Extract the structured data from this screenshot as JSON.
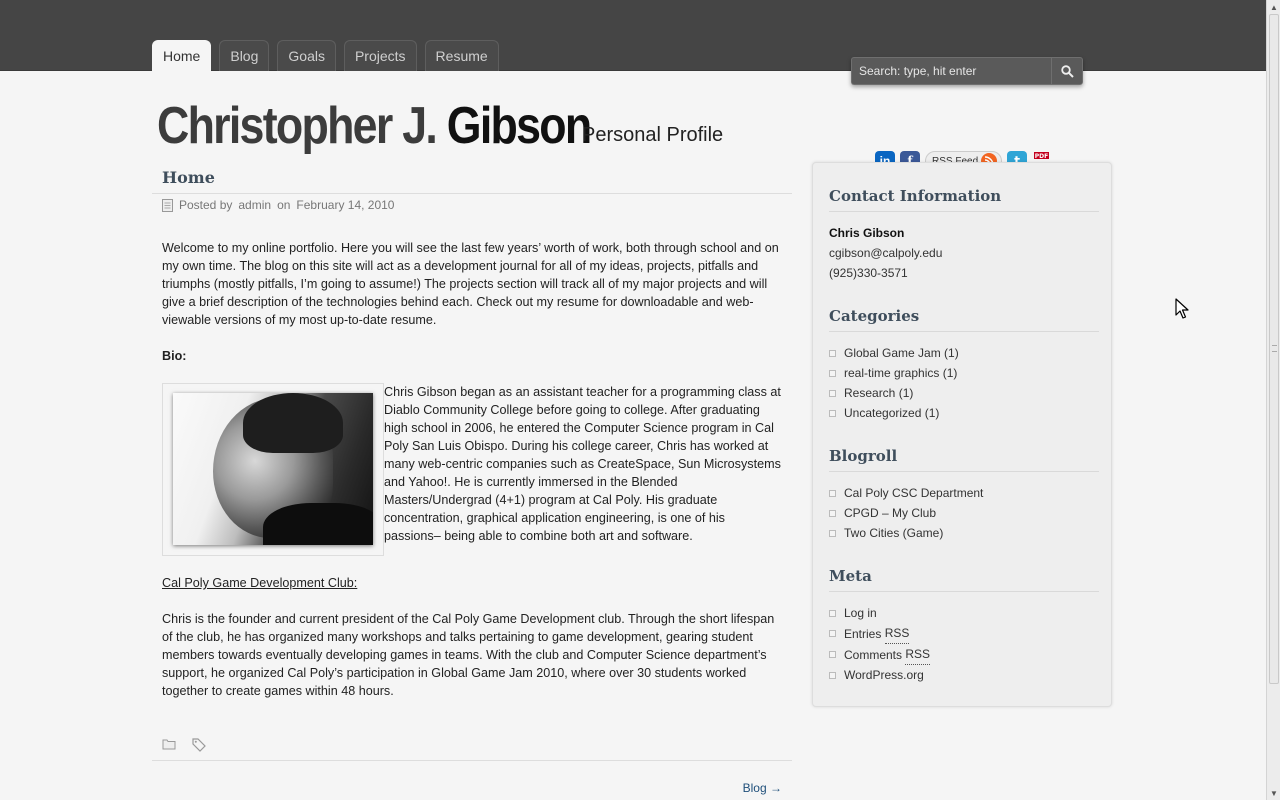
{
  "nav": {
    "tabs": [
      {
        "label": "Home",
        "active": true
      },
      {
        "label": "Blog"
      },
      {
        "label": "Goals"
      },
      {
        "label": "Projects"
      },
      {
        "label": "Resume"
      }
    ]
  },
  "search": {
    "placeholder": "Search: type, hit enter"
  },
  "site": {
    "first_name": "Christopher J. ",
    "last_name": "Gibson",
    "tagline": "Personal Profile"
  },
  "social": {
    "icons": [
      "linkedin-icon",
      "facebook-icon",
      "rss-icon",
      "twitter-icon",
      "pdf-icon"
    ],
    "rss_label": "RSS Feed"
  },
  "post": {
    "title": "Home",
    "meta_prefix": "Posted by",
    "author": "admin",
    "meta_on": "on",
    "date": "February 14, 2010",
    "intro": "Welcome to my online portfolio.  Here you will see the last few years’ worth of work, both through school and on my own time.  The blog on this site will act as a development journal for all of my ideas, projects, pitfalls and triumphs (mostly pitfalls, I’m going to assume!)  The projects section will track all of my major projects and will give a brief description of the technologies behind each.  Check out my resume for downloadable and web-viewable versions of my most up-to-date resume.",
    "bio_label": "Bio:",
    "bio_text": "Chris Gibson began as an assistant teacher for a programming class at Diablo Community College before going to college.  After graduating high school in 2006, he entered the Computer Science program in Cal Poly San Luis Obispo.  During his college career, Chris has worked at many web-centric companies such as CreateSpace, Sun Microsystems and Yahoo!.  He is currently immersed in the Blended Masters/Undergrad (4+1) program at Cal Poly.  His graduate concentration, graphical application engineering, is one of his passions– being able to combine both art and software.",
    "club_link": "Cal Poly Game Development Club:",
    "club_text": "Chris is the founder and current president of the Cal Poly Game Development club.  Through the short lifespan of the club, he has organized many workshops and talks pertaining to game development, gearing student members towards eventually developing games in teams.  With the club and Computer Science department’s support, he organized Cal Poly’s participation in Global Game Jam 2010, where over 30 students worked together to create games within 48 hours.",
    "next_link": "Blog →"
  },
  "sidebar": {
    "contact": {
      "title": "Contact Information",
      "name": "Chris Gibson",
      "email": "cgibson@calpoly.edu",
      "phone": "(925)330-3571"
    },
    "categories": {
      "title": "Categories",
      "items": [
        "Global Game Jam (1)",
        "real-time graphics (1)",
        "Research (1)",
        "Uncategorized (1)"
      ]
    },
    "blogroll": {
      "title": "Blogroll",
      "items": [
        "Cal Poly CSC Department",
        "CPGD – My Club",
        "Two Cities (Game)"
      ]
    },
    "meta": {
      "title": "Meta",
      "login": "Log in",
      "entries": "Entries",
      "comments": "Comments",
      "rss": "RSS",
      "wordpress": "WordPress.org"
    }
  },
  "colors": {
    "topbar": "#454545",
    "heading": "#3f4e5c",
    "link": "#1f4f7a",
    "linkedin": "#0a66c2",
    "facebook": "#3b5998",
    "rss": "#f26522",
    "twitter": "#2fa5d6",
    "pdf": "#c4001e"
  }
}
